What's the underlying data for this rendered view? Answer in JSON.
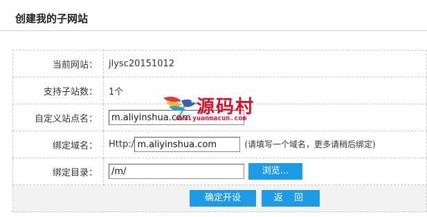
{
  "page": {
    "title": "创建我的子网站"
  },
  "form": {
    "current_site_label": "当前网站：",
    "current_site_value": "jlysc20151012",
    "subsite_count_label": "支持子站数：",
    "subsite_count_value": "1个",
    "site_name_label": "自定义站点名：",
    "site_name_value": "m.aliyinshua.com",
    "domain_label": "绑定域名：",
    "domain_prefix": "Http://",
    "domain_value": "m.aliyinshua.com",
    "domain_hint": "(请填写一个域名，更多请稍后绑定)",
    "dir_label": "绑定目录：",
    "dir_value": "/m/",
    "browse_label": "浏览..."
  },
  "actions": {
    "confirm_label": "确定开设",
    "back_label": "返 回"
  },
  "watermark": {
    "text": "源码村",
    "url": "www.yuanmacun.com"
  },
  "colors": {
    "button_blue": "#1e9be6",
    "watermark_red": "#d8102a"
  }
}
